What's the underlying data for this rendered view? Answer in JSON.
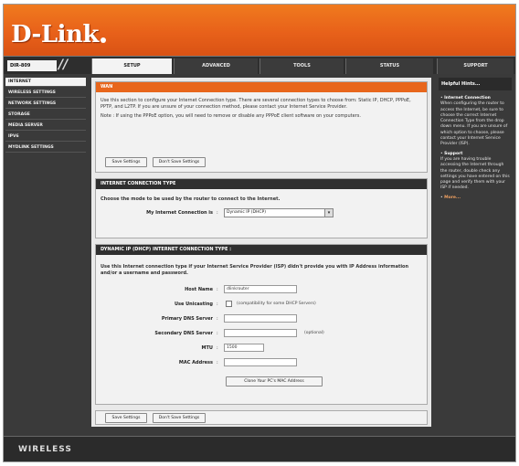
{
  "brand": {
    "logo": "D-Link"
  },
  "tabbar": {
    "model": "DIR-809",
    "tabs": [
      "SETUP",
      "ADVANCED",
      "TOOLS",
      "STATUS",
      "SUPPORT"
    ]
  },
  "sidebar": {
    "items": [
      "INTERNET",
      "WIRELESS SETTINGS",
      "NETWORK SETTINGS",
      "STORAGE",
      "MEDIA SERVER",
      "IPV6",
      "MYDLINK SETTINGS"
    ]
  },
  "wan": {
    "title": "WAN",
    "desc": "Use this section to configure your Internet Connection type. There are several connection types to choose from: Static IP, DHCP, PPPoE, PPTP, and L2TP. If you are unsure of your connection method, please contact your Internet Service Provider.",
    "note": "Note : If using the PPPoE option, you will need to remove or disable any PPPoE client software on your computers.",
    "save": "Save Settings",
    "dont_save": "Don't Save Settings"
  },
  "conn_type": {
    "title": "INTERNET CONNECTION TYPE",
    "desc": "Choose the mode to be used by the router to connect to the Internet.",
    "label": "My Internet Connection is",
    "selected": "Dynamic IP (DHCP)"
  },
  "dhcp": {
    "title": "DYNAMIC IP (DHCP) INTERNET CONNECTION TYPE :",
    "desc": "Use this Internet connection type if your Internet Service Provider (ISP) didn't provide you with IP Address information and/or a username and password.",
    "host_label": "Host Name",
    "host_value": "dlinkrouter",
    "unicast_label": "Use Unicasting",
    "unicast_note": "(compatibility for some DHCP Servers)",
    "primary_dns_label": "Primary DNS Server",
    "secondary_dns_label": "Secondary DNS Server",
    "optional": "(optional)",
    "mtu_label": "MTU",
    "mtu_value": "1500",
    "mac_label": "MAC Address",
    "clone_button": "Clone Your PC's MAC Address"
  },
  "bottom": {
    "save": "Save Settings",
    "dont_save": "Don't Save Settings"
  },
  "help": {
    "title": "Helpful Hints...",
    "head1": "Internet Connection",
    "body1": "When configuring the router to access the Internet, be sure to choose the correct Internet Connection Type from the drop down menu. If you are unsure of which option to choose, please contact your Internet Service Provider (ISP).",
    "head2": "Support",
    "body2": "If you are having trouble accessing the Internet through the router, double check any settings you have entered on this page and verify them with your ISP if needed.",
    "more": "More..."
  },
  "footer": {
    "brand": "WIRELESS"
  }
}
